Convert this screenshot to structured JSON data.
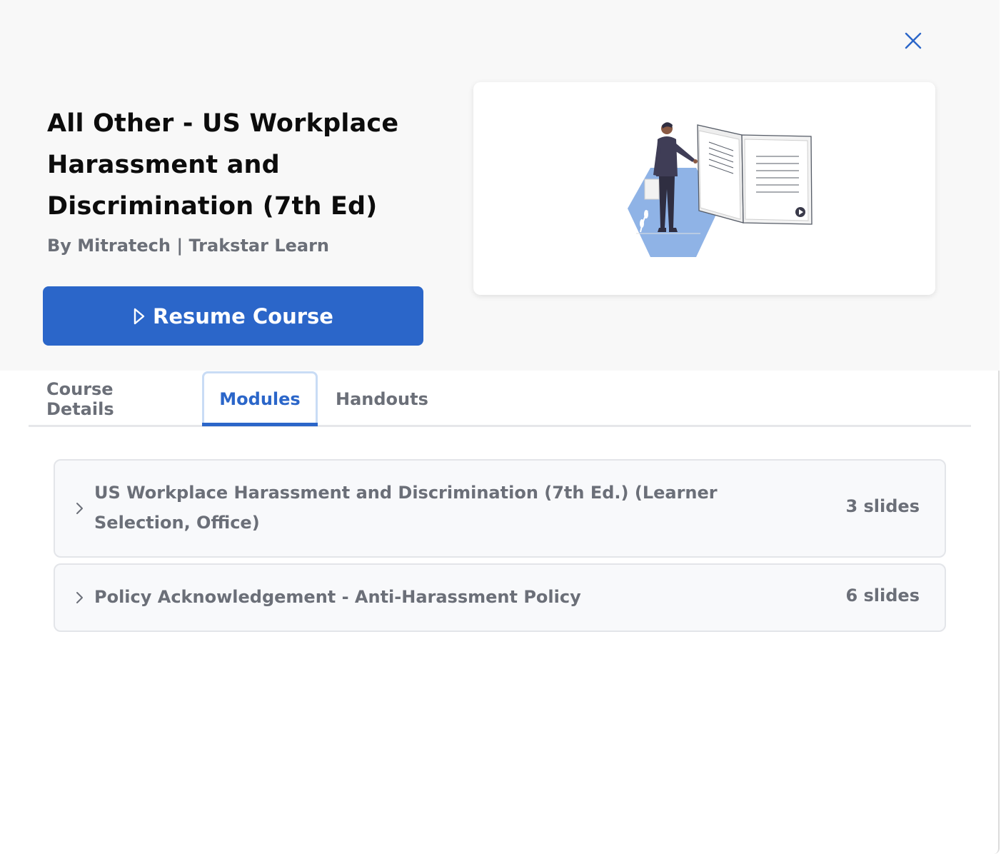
{
  "course": {
    "title": "All Other - US Workplace Harassment and Discrimination (7th Ed)",
    "author": "By Mitratech | Trakstar Learn",
    "resume_label": "Resume Course"
  },
  "tabs": [
    {
      "label": "Course Details",
      "active": false
    },
    {
      "label": "Modules",
      "active": true
    },
    {
      "label": "Handouts",
      "active": false
    }
  ],
  "modules": [
    {
      "title": "US Workplace Harassment and Discrimination (7th Ed.) (Learner Selection, Office)",
      "slides": "3 slides"
    },
    {
      "title": "Policy Acknowledgement - Anti-Harassment Policy",
      "slides": "6 slides"
    }
  ],
  "colors": {
    "accent": "#2b66c9",
    "muted_text": "#6b6f78",
    "hero_background": "#f8f8f8",
    "hexagon": "#8fb3e6"
  },
  "icons": {
    "close": "close-icon",
    "play": "play-outline-icon",
    "chevron": "chevron-right-icon"
  }
}
